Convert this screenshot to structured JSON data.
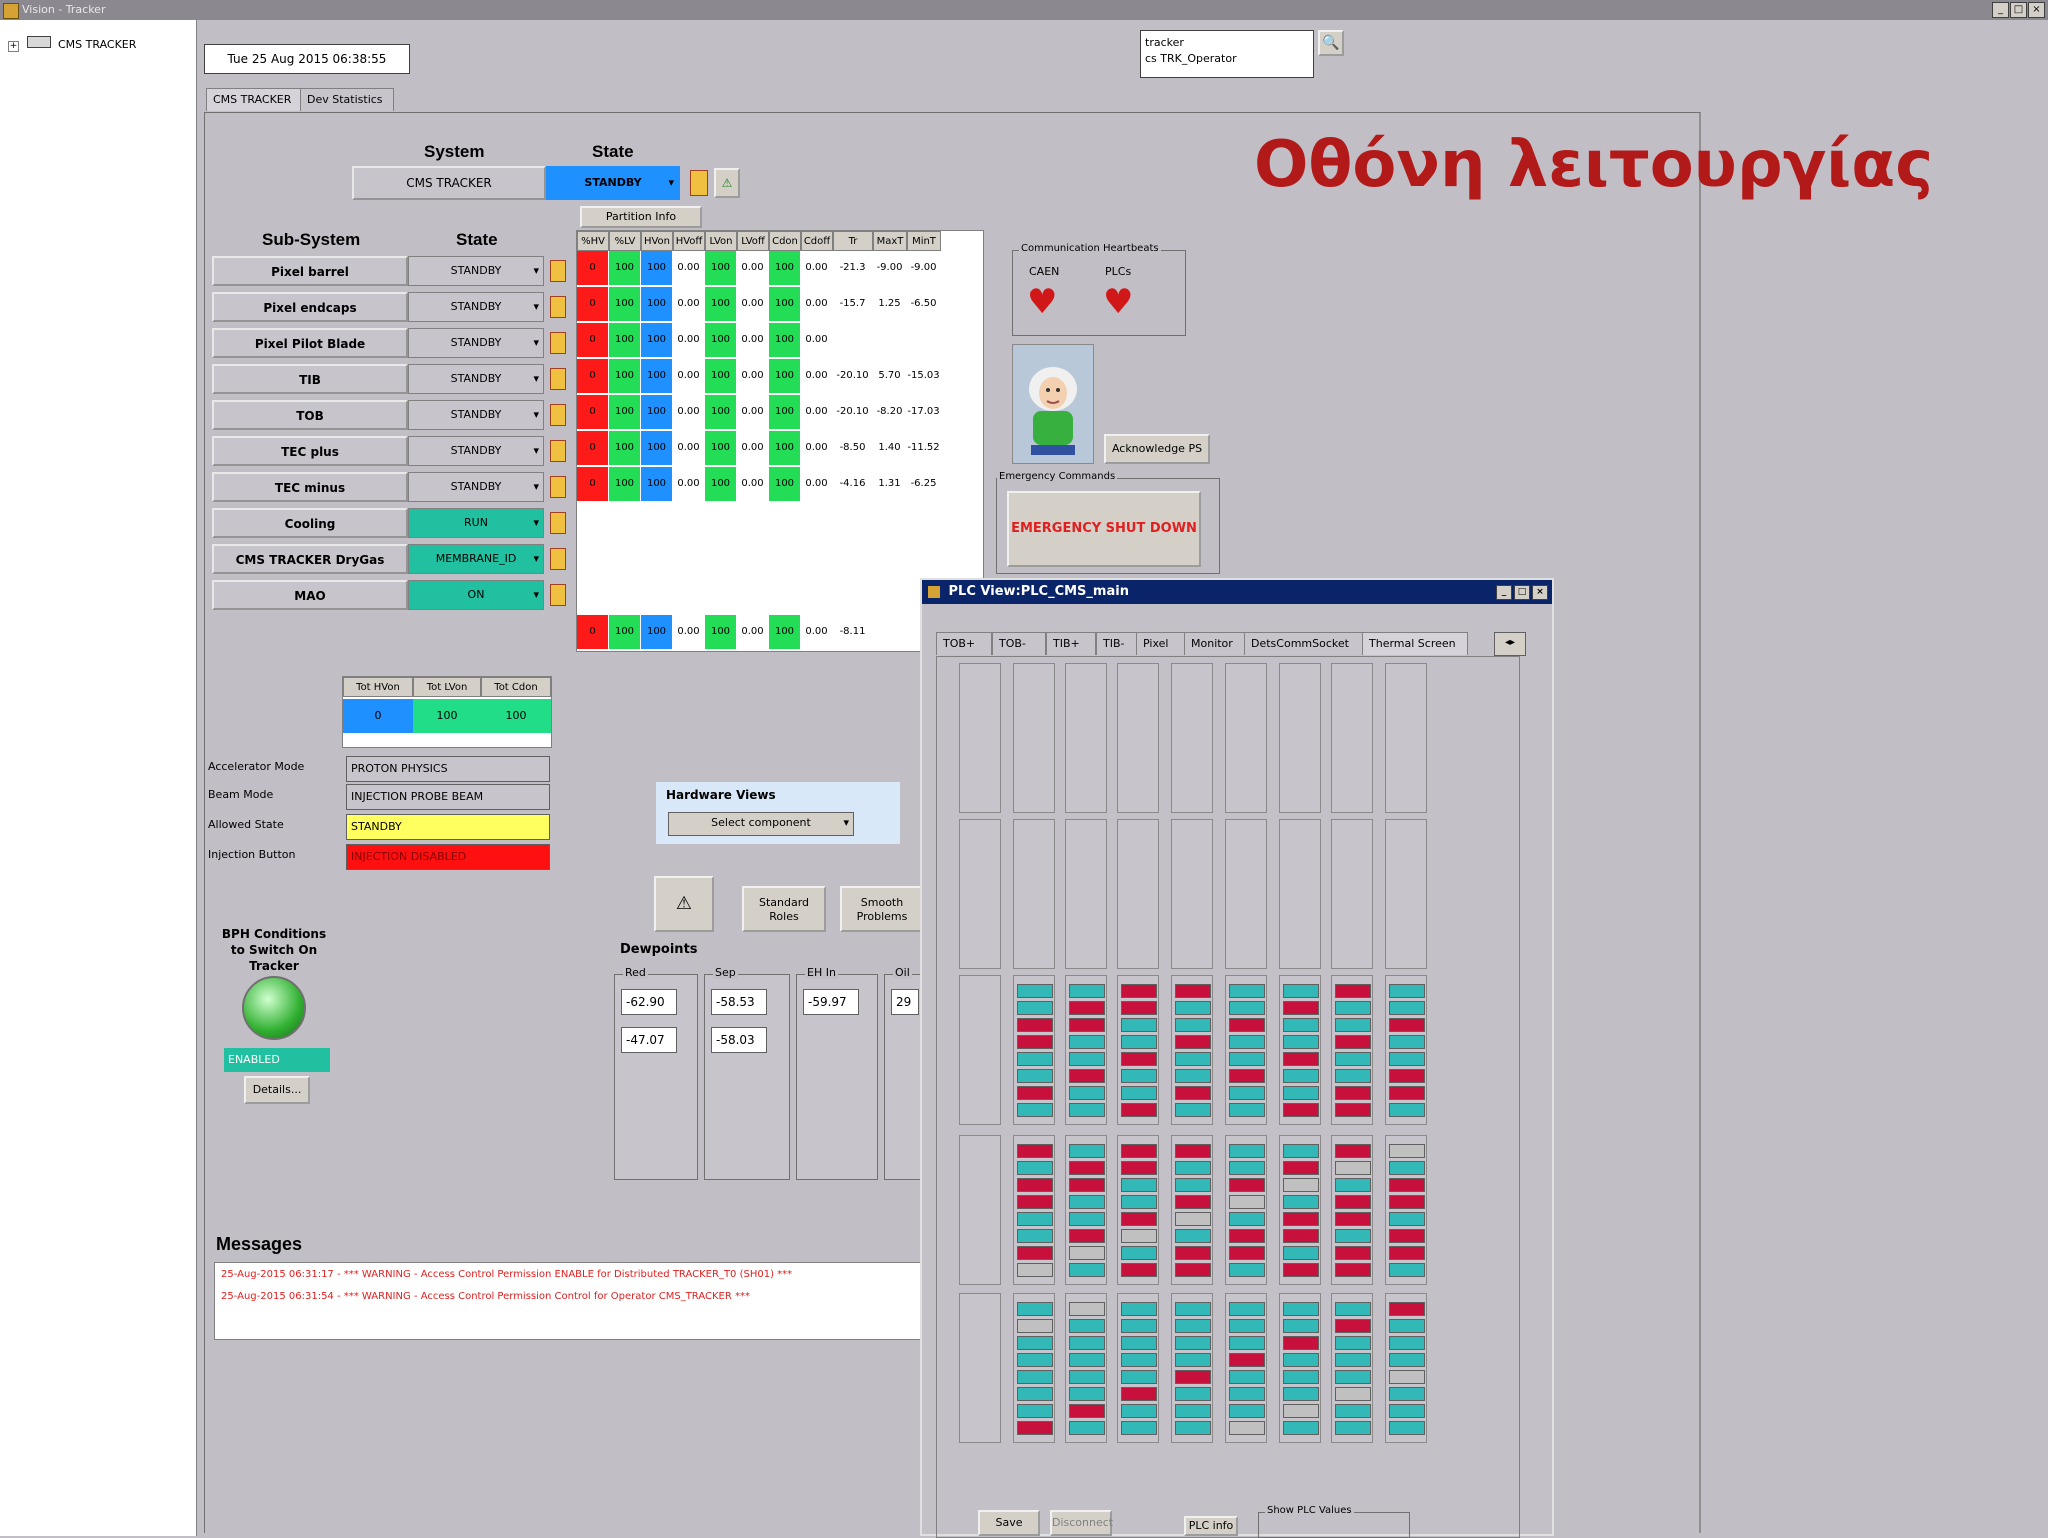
{
  "window": {
    "title": "Vision - Tracker"
  },
  "tree": {
    "root": "CMS TRACKER"
  },
  "datetime": "Tue 25 Aug 2015  06:38:55",
  "login": {
    "line1": "tracker",
    "line2": "cs TRK_Operator"
  },
  "tabs": [
    "CMS TRACKER",
    "Dev Statistics"
  ],
  "overlay_title": "Οθόνη λειτουργίας",
  "system": {
    "header_system": "System",
    "header_state": "State",
    "name": "CMS TRACKER",
    "state": "STANDBY"
  },
  "subsystem": {
    "header_name": "Sub-System",
    "header_state": "State",
    "rows": [
      {
        "name": "Pixel barrel",
        "state": "STANDBY"
      },
      {
        "name": "Pixel endcaps",
        "state": "STANDBY"
      },
      {
        "name": "Pixel Pilot Blade",
        "state": "STANDBY"
      },
      {
        "name": "TIB",
        "state": "STANDBY"
      },
      {
        "name": "TOB",
        "state": "STANDBY"
      },
      {
        "name": "TEC plus",
        "state": "STANDBY"
      },
      {
        "name": "TEC minus",
        "state": "STANDBY"
      },
      {
        "name": "Cooling",
        "state": "RUN"
      },
      {
        "name": "CMS TRACKER DryGas",
        "state": "MEMBRANE_ID"
      },
      {
        "name": "MAO",
        "state": "ON"
      }
    ]
  },
  "partition_info": {
    "button": "Partition Info",
    "headers": [
      "%HV",
      "%LV",
      "HVon",
      "HVoff",
      "LVon",
      "LVoff",
      "Cdon",
      "Cdoff",
      "Tr",
      "MaxT",
      "MinT"
    ],
    "rows": [
      [
        "0",
        "100",
        "100",
        "0.00",
        "100",
        "0.00",
        "100",
        "0.00",
        "-21.3",
        "-9.00",
        "-9.00"
      ],
      [
        "0",
        "100",
        "100",
        "0.00",
        "100",
        "0.00",
        "100",
        "0.00",
        "-15.7",
        "1.25",
        "-6.50"
      ],
      [
        "0",
        "100",
        "100",
        "0.00",
        "100",
        "0.00",
        "100",
        "0.00",
        "",
        "",
        ""
      ],
      [
        "0",
        "100",
        "100",
        "0.00",
        "100",
        "0.00",
        "100",
        "0.00",
        "-20.10",
        "5.70",
        "-15.03"
      ],
      [
        "0",
        "100",
        "100",
        "0.00",
        "100",
        "0.00",
        "100",
        "0.00",
        "-20.10",
        "-8.20",
        "-17.03"
      ],
      [
        "0",
        "100",
        "100",
        "0.00",
        "100",
        "0.00",
        "100",
        "0.00",
        "-8.50",
        "1.40",
        "-11.52"
      ],
      [
        "0",
        "100",
        "100",
        "0.00",
        "100",
        "0.00",
        "100",
        "0.00",
        "-4.16",
        "1.31",
        "-6.25"
      ]
    ],
    "total_row": [
      "0",
      "100",
      "100",
      "0.00",
      "100",
      "0.00",
      "100",
      "0.00",
      "-8.11"
    ]
  },
  "heartbeats": {
    "title": "Communication Heartbeats",
    "caen": "CAEN",
    "plcs": "PLCs"
  },
  "acknowledge_button": "Acknowledge PS",
  "emergency": {
    "title": "Emergency Commands",
    "button": "EMERGENCY SHUT DOWN"
  },
  "totals": {
    "headers": [
      "Tot HVon",
      "Tot LVon",
      "Tot Cdon"
    ],
    "values": [
      "0",
      "100",
      "100"
    ]
  },
  "beam": {
    "labels": [
      "Accelerator Mode",
      "Beam Mode",
      "Allowed State",
      "Injection Button"
    ],
    "values": [
      "PROTON PHYSICS",
      "INJECTION PROBE BEAM",
      "STANDBY",
      "INJECTION DISABLED"
    ]
  },
  "hardware_views": {
    "title": "Hardware Views",
    "select": "Select component"
  },
  "buttons": {
    "fsm_up": "⚠",
    "standard_roles": "Standard Roles",
    "smooth_problems": "Smooth Problems"
  },
  "dewpoints": {
    "title": "Dewpoints",
    "groups": [
      {
        "label": "Red",
        "values": [
          "-62.90",
          "-47.07"
        ]
      },
      {
        "label": "Sep",
        "values": [
          "-58.53",
          "-58.03"
        ]
      },
      {
        "label": "EH In",
        "values": [
          "-59.97"
        ]
      },
      {
        "label": "Oil",
        "values": [
          "29"
        ]
      }
    ]
  },
  "bph": {
    "title": "BPH Conditions to Switch On Tracker",
    "status": "ENABLED",
    "details": "Details..."
  },
  "messages": {
    "title": "Messages",
    "lines": [
      "25-Aug-2015 06:31:17 - *** WARNING - Access Control Permission ENABLE for Distributed TRACKER_T0 (SH01) ***",
      "25-Aug-2015 06:31:54 - *** WARNING - Access Control Permission Control for Operator CMS_TRACKER ***"
    ]
  },
  "plc": {
    "title": "PLC View:PLC_CMS_main",
    "tabs": [
      "TOB+",
      "TOB-",
      "TIB+",
      "TIB-",
      "Pixel",
      "Monitor",
      "DetsCommSocket",
      "Thermal Screen"
    ],
    "bottom": {
      "b1": "Save",
      "b2": "Disconnect",
      "b3": "PLC info",
      "legend": "Show PLC Values"
    }
  },
  "colors": {
    "accent_red": "#b21a1a",
    "blue_state": "#1e90ff",
    "green_state": "#22dd55",
    "run_state": "#20c0a0"
  }
}
